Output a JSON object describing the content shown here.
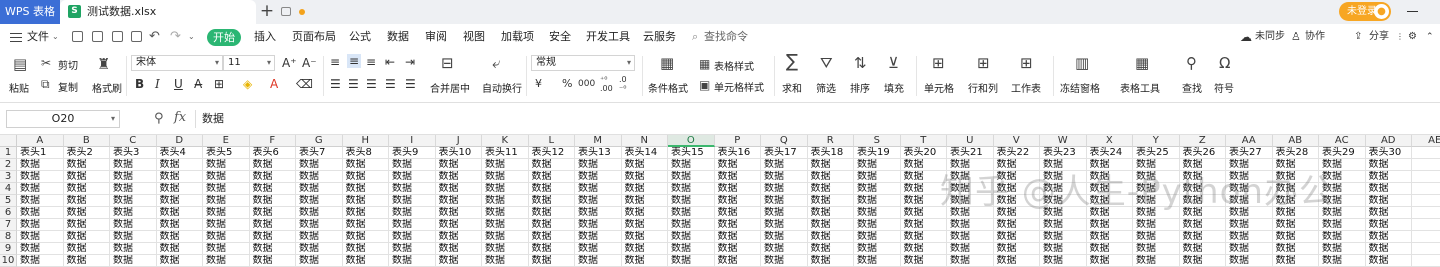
{
  "titlebar": {
    "app_label": "WPS 表格",
    "file_name": "测试数据.xlsx",
    "file_icon_letter": "S",
    "new_tab_label": "+",
    "login_label": "未登录"
  },
  "menubar": {
    "file_label": "文件",
    "start_label": "开始",
    "tabs": [
      "插入",
      "页面布局",
      "公式",
      "数据",
      "审阅",
      "视图",
      "加载项",
      "安全",
      "开发工具",
      "云服务"
    ],
    "search_label": "查找命令",
    "sync_label": "未同步",
    "collab_label": "协作",
    "share_label": "分享"
  },
  "ribbon": {
    "paste_label": "粘贴",
    "cut_label": "剪切",
    "copy_label": "复制",
    "format_painter_label": "格式刷",
    "font_name": "宋体",
    "font_size": "11",
    "bold": "B",
    "italic": "I",
    "underline": "U",
    "merge_label": "合并居中",
    "wrap_label": "自动换行",
    "number_format": "常规",
    "percent": "%",
    "thousand_sep": "000",
    "currency": "¥",
    "cond_format_label": "条件格式",
    "table_style_label": "表格样式",
    "cell_style_label": "单元格样式",
    "sum_label": "求和",
    "filter_label": "筛选",
    "sort_label": "排序",
    "fill_label": "填充",
    "cell_label": "单元格",
    "rowcol_label": "行和列",
    "sheet_label": "工作表",
    "freeze_label": "冻结窗格",
    "table_tools_label": "表格工具",
    "find_label": "查找",
    "symbol_label": "符号"
  },
  "formulabar": {
    "cell_ref": "O20",
    "fx": "fx",
    "content": "数据"
  },
  "grid": {
    "columns": [
      "A",
      "B",
      "C",
      "D",
      "E",
      "F",
      "G",
      "H",
      "I",
      "J",
      "K",
      "L",
      "M",
      "N",
      "O",
      "P",
      "Q",
      "R",
      "S",
      "T",
      "U",
      "V",
      "W",
      "X",
      "Y",
      "Z",
      "AA",
      "AB",
      "AC",
      "AD",
      "AE"
    ],
    "selected_column": "O",
    "rows": [
      "1",
      "2",
      "3",
      "4",
      "5",
      "6",
      "7",
      "8",
      "9",
      "10"
    ],
    "headers": [
      "表头1",
      "表头2",
      "表头3",
      "表头4",
      "表头5",
      "表头6",
      "表头7",
      "表头8",
      "表头9",
      "表头10",
      "表头11",
      "表头12",
      "表头13",
      "表头14",
      "表头15",
      "表头16",
      "表头17",
      "表头18",
      "表头19",
      "表头20",
      "表头21",
      "表头22",
      "表头23",
      "表头24",
      "表头25",
      "表头26",
      "表头27",
      "表头28",
      "表头29",
      "表头30"
    ],
    "data_value": "数据"
  },
  "watermark": "知乎 @人生-Python办公",
  "colors": {
    "accent_green": "#2bb673",
    "app_blue": "#3b6ed6",
    "login_orange": "#f7a623"
  }
}
